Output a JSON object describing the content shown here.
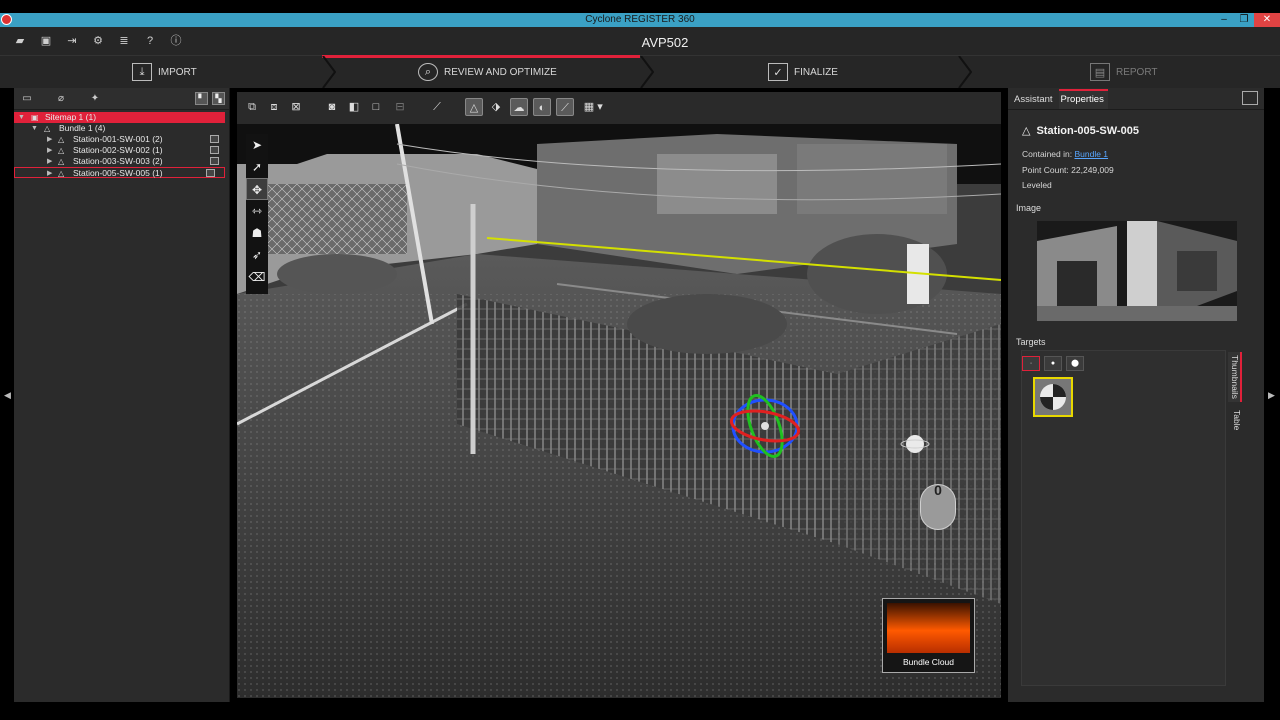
{
  "window": {
    "title": "Cyclone REGISTER 360",
    "controls": {
      "minimize": "–",
      "maximize": "❐",
      "close": "✕"
    }
  },
  "appbar": {
    "project_name": "AVP502",
    "quick_icons": [
      "folder-open-icon",
      "folder-icon",
      "import-icon",
      "gear-icon",
      "database-icon",
      "help-icon",
      "info-icon"
    ]
  },
  "workflow": {
    "steps": [
      {
        "label": "IMPORT",
        "icon": "import-icon"
      },
      {
        "label": "REVIEW AND OPTIMIZE",
        "icon": "review-icon"
      },
      {
        "label": "FINALIZE",
        "icon": "finalize-icon"
      },
      {
        "label": "REPORT",
        "icon": "report-icon"
      }
    ],
    "active_color": "#e0213a"
  },
  "tree": {
    "sitemap": "Sitemap 1 (1)",
    "bundle": "Bundle 1 (4)",
    "stations": [
      "Station-001-SW-001 (2)",
      "Station-002-SW-002 (1)",
      "Station-003-SW-003 (2)",
      "Station-005-SW-005 (1)"
    ]
  },
  "viewport": {
    "bundle_thumb_label": "Bundle Cloud",
    "mouse_hint": "0"
  },
  "right": {
    "tabs": [
      "Assistant",
      "Properties"
    ],
    "station_title": "Station-005-SW-005",
    "contained_in_label": "Contained in:",
    "contained_in_value": "Bundle 1",
    "point_count_label": "Point Count:",
    "point_count_value": "22,249,009",
    "leveled": "Leveled",
    "image_label": "Image",
    "targets_label": "Targets",
    "vtabs": [
      "Thumbnails",
      "Table"
    ]
  }
}
